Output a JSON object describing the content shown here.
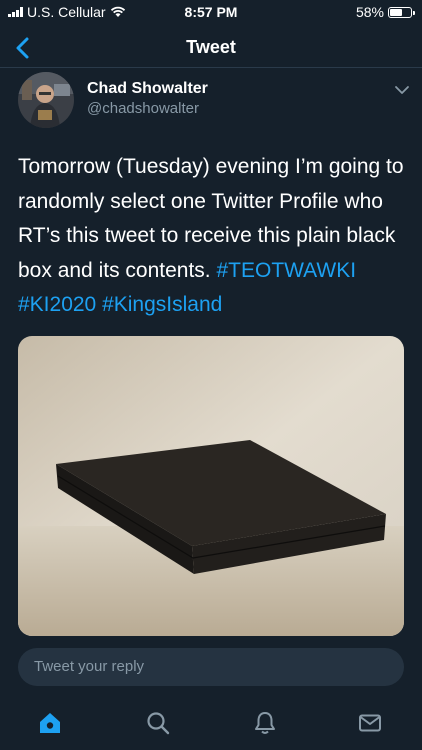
{
  "status_bar": {
    "carrier": "U.S. Cellular",
    "time": "8:57 PM",
    "battery_text": "58%",
    "battery_level": 0.58
  },
  "nav": {
    "title": "Tweet",
    "back_icon": "back-chevron-icon"
  },
  "tweet": {
    "author_name": "Chad Showalter",
    "author_handle": "@chadshowalter",
    "text": "Tomorrow (Tuesday) evening I’m going to randomly select one Twitter Profile who RT’s this tweet to receive this plain black box and its contents.",
    "hashtags": "#TEOTWAWKI #KI2020 #KingsIsland",
    "media_description_icon": "photo-black-box"
  },
  "reply": {
    "placeholder": "Tweet your reply"
  },
  "tabs": [
    {
      "name": "home",
      "icon": "home-icon",
      "active": true
    },
    {
      "name": "search",
      "icon": "search-icon",
      "active": false
    },
    {
      "name": "notifications",
      "icon": "bell-icon",
      "active": false
    },
    {
      "name": "messages",
      "icon": "mail-icon",
      "active": false
    }
  ],
  "colors": {
    "background": "#15202b",
    "accent": "#1da1f2",
    "muted": "#8899a6",
    "reply_bg": "#253341"
  }
}
